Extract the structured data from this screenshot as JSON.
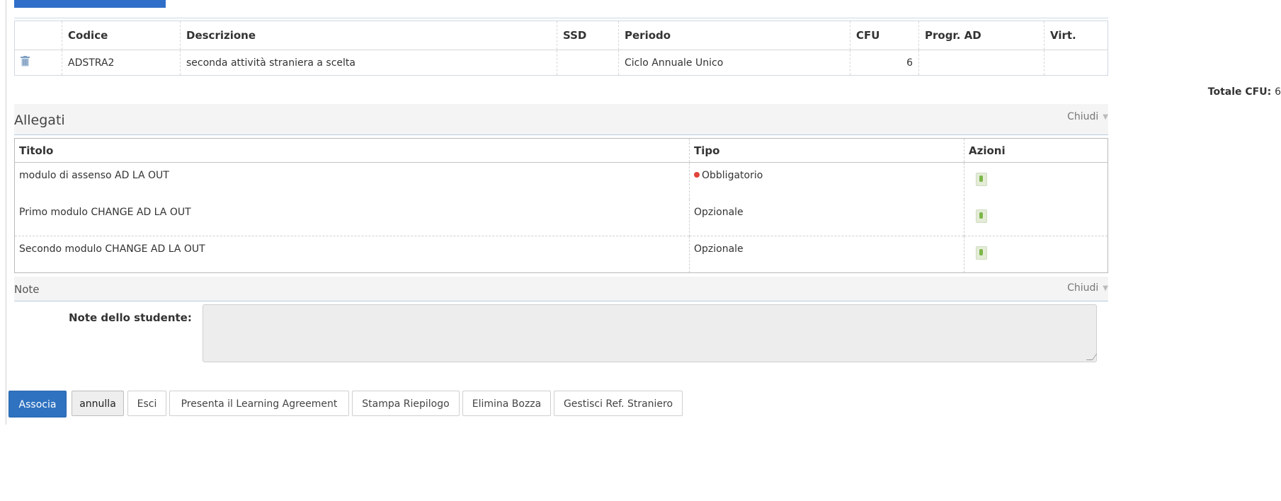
{
  "ad_table": {
    "headers": {
      "codice": "Codice",
      "descrizione": "Descrizione",
      "ssd": "SSD",
      "periodo": "Periodo",
      "cfu": "CFU",
      "progr_ad": "Progr. AD",
      "virt": "Virt."
    },
    "rows": [
      {
        "codice": "ADSTRA2",
        "descrizione": "seconda attività straniera a scelta",
        "ssd": "",
        "periodo": "Ciclo Annuale Unico",
        "cfu": "6",
        "progr_ad": "",
        "virt": ""
      }
    ],
    "totale_label": "Totale CFU:",
    "totale_value": "6"
  },
  "allegati": {
    "title": "Allegati",
    "close_label": "Chiudi",
    "headers": {
      "titolo": "Titolo",
      "tipo": "Tipo",
      "azioni": "Azioni"
    },
    "rows": [
      {
        "titolo": "modulo di assenso AD LA OUT",
        "tipo": "Obbligatorio",
        "required": true
      },
      {
        "titolo": "Primo modulo CHANGE AD LA OUT",
        "tipo": "Opzionale",
        "required": false
      },
      {
        "titolo": "Secondo modulo CHANGE AD LA OUT",
        "tipo": "Opzionale",
        "required": false
      }
    ]
  },
  "note": {
    "title": "Note",
    "close_label": "Chiudi",
    "field_label": "Note dello studente:",
    "value": ""
  },
  "buttons": {
    "associa": "Associa",
    "annulla": "annulla",
    "esci": "Esci",
    "presenta": "Presenta il Learning Agreement",
    "stampa": "Stampa Riepilogo",
    "elimina": "Elimina Bozza",
    "gestisci": "Gestisci Ref. Straniero"
  },
  "colors": {
    "primary": "#2f72c0",
    "required_dot": "#e2443a",
    "section_rule": "#b8cde0"
  }
}
